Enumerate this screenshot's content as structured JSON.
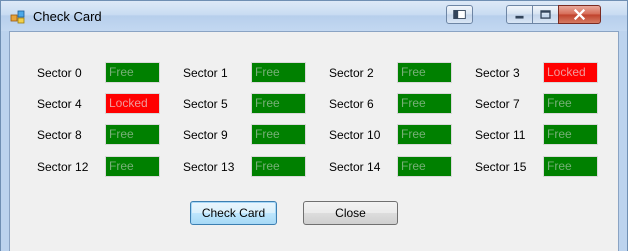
{
  "window": {
    "title": "Check Card"
  },
  "sectors": [
    {
      "label": "Sector 0",
      "status": "Free"
    },
    {
      "label": "Sector 1",
      "status": "Free"
    },
    {
      "label": "Sector 2",
      "status": "Free"
    },
    {
      "label": "Sector 3",
      "status": "Locked"
    },
    {
      "label": "Sector 4",
      "status": "Locked"
    },
    {
      "label": "Sector 5",
      "status": "Free"
    },
    {
      "label": "Sector 6",
      "status": "Free"
    },
    {
      "label": "Sector 7",
      "status": "Free"
    },
    {
      "label": "Sector 8",
      "status": "Free"
    },
    {
      "label": "Sector 9",
      "status": "Free"
    },
    {
      "label": "Sector 10",
      "status": "Free"
    },
    {
      "label": "Sector 11",
      "status": "Free"
    },
    {
      "label": "Sector 12",
      "status": "Free"
    },
    {
      "label": "Sector 13",
      "status": "Free"
    },
    {
      "label": "Sector 14",
      "status": "Free"
    },
    {
      "label": "Sector 15",
      "status": "Free"
    }
  ],
  "buttons": {
    "check_card": "Check Card",
    "close": "Close"
  },
  "colors": {
    "free": "#008000",
    "locked": "#ff0000"
  }
}
